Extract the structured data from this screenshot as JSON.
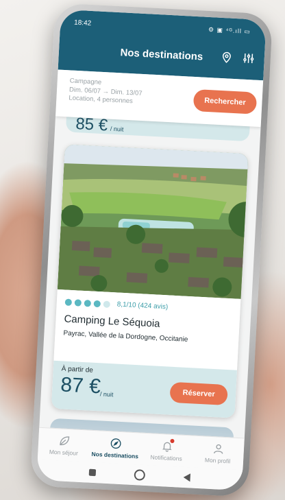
{
  "status": {
    "time": "18:42",
    "icons": "⚙ ▣ ⁴ᴳ.ıll ▭"
  },
  "header": {
    "title": "Nos destinations"
  },
  "search": {
    "type": "Campagne",
    "dates": "Dim. 06/07 → Dim. 13/07",
    "guests": "Location, 4 personnes",
    "button": "Rechercher"
  },
  "previous_card": {
    "price_partial": "85 €",
    "unit": "/ nuit"
  },
  "campsite": {
    "rating_dots": 5,
    "rating_filled": 4,
    "score": "8,1/10 (424 avis)",
    "name": "Camping Le Séquoia",
    "location": "Payrac, Vallée de la Dordogne, Occitanie",
    "price_label": "À partir de",
    "price": "87 €",
    "price_unit": "/ nuit",
    "book_button": "Réserver"
  },
  "tabs": [
    {
      "label": "Mon séjour",
      "icon": "leaf-icon"
    },
    {
      "label": "Nos destinations",
      "icon": "compass-icon",
      "active": true
    },
    {
      "label": "Notifications",
      "icon": "bell-icon",
      "badge": true
    },
    {
      "label": "Mon profil",
      "icon": "user-icon"
    }
  ],
  "colors": {
    "header": "#1c5f78",
    "accent": "#e8734f",
    "price_bg": "#d4e8ea",
    "rating": "#5bb8c2"
  }
}
